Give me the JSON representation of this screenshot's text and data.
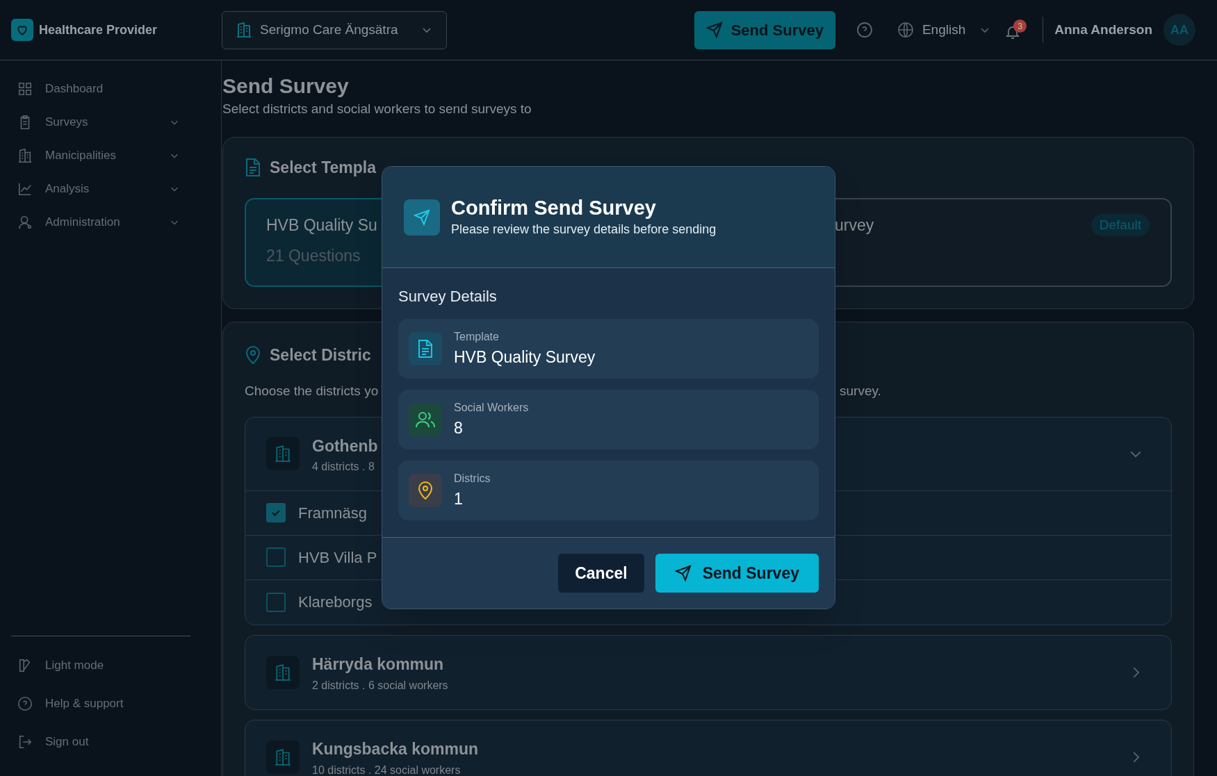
{
  "header": {
    "brand": "Healthcare Provider",
    "location": "Serigmo Care Ängsätra",
    "send_button": "Send Survey",
    "language": "English",
    "notification_count": "3",
    "user_name": "Anna Anderson",
    "avatar_initials": "AA"
  },
  "sidebar": {
    "items": [
      {
        "kind": "grid",
        "label": "Dashboard",
        "expandable": false
      },
      {
        "kind": "clipboard",
        "label": "Surveys",
        "expandable": true
      },
      {
        "kind": "building",
        "label": "Manicipalities",
        "expandable": true
      },
      {
        "kind": "chart",
        "label": "Analysis",
        "expandable": true
      },
      {
        "kind": "user",
        "label": "Administration",
        "expandable": true
      }
    ],
    "footer_items": [
      {
        "kind": "theme",
        "label": "Light mode"
      },
      {
        "kind": "help",
        "label": "Help & support"
      },
      {
        "kind": "signout",
        "label": "Sign out"
      }
    ]
  },
  "page": {
    "title": "Send Survey",
    "subtitle": "Select districts and social workers to send surveys to"
  },
  "template_section": {
    "title": "Select Templa",
    "templates": [
      {
        "title": "HVB Quality Su",
        "subtitle": "21 Questions",
        "selected": true
      },
      {
        "title": "urvey",
        "badge": "Default",
        "selected": false
      }
    ]
  },
  "district_section": {
    "title": "Select Distric",
    "description_start": "Choose the districts yo",
    "description_end": "survey.",
    "municipalities": [
      {
        "name": "Gothenb",
        "summary": "4 districts . 8",
        "expanded": true,
        "districts": [
          {
            "name": "Framnäsg",
            "checked": true
          },
          {
            "name": "HVB Villa P",
            "checked": false
          },
          {
            "name": "Klareborgs",
            "checked": false
          }
        ]
      },
      {
        "name": "Härryda kommun",
        "summary": "2 districts . 6 social workers",
        "expanded": false
      },
      {
        "name": "Kungsbacka kommun",
        "summary": "10 districts . 24 social workers",
        "expanded": false
      }
    ]
  },
  "dialog": {
    "title": "Confirm Send Survey",
    "subtitle": "Please review the survey details before sending",
    "section_title": "Survey Details",
    "details": [
      {
        "kind": "template",
        "label": "Template",
        "value": "HVB Quality Survey"
      },
      {
        "kind": "workers",
        "label": "Social Workers",
        "value": "8"
      },
      {
        "kind": "districts",
        "label": "Districs",
        "value": "1"
      }
    ],
    "cancel": "Cancel",
    "confirm": "Send Survey"
  }
}
